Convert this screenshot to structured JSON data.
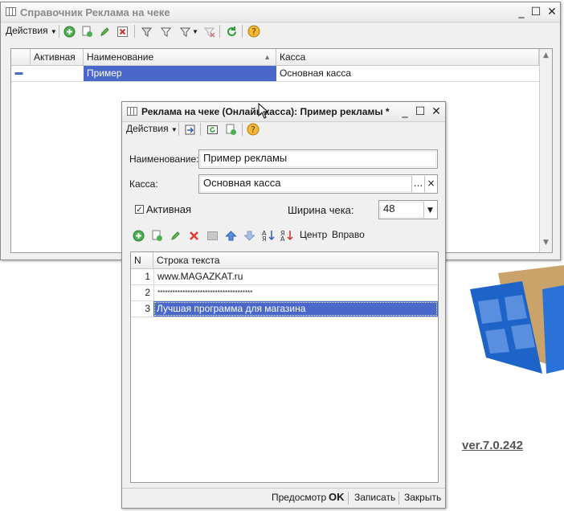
{
  "background": {
    "version": "ver.7.0.242"
  },
  "main_window": {
    "title": "Справочник Реклама на чеке",
    "menu_label": "Действия",
    "columns": [
      "Активная",
      "Наименование",
      "Касса"
    ],
    "rows": [
      {
        "active": "",
        "name": "Пример",
        "register": "Основная касса"
      }
    ]
  },
  "dialog": {
    "title": "Реклама на чеке (Онлайн касса): Пример рекламы *",
    "menu_label": "Действия",
    "name_label": "Наименование:",
    "name_value": "Пример рекламы",
    "register_label": "Касса:",
    "register_value": "Основная касса",
    "register_choose": "...",
    "register_clear": "×",
    "active_label": "Активная",
    "active_checked": true,
    "width_label": "Ширина чека:",
    "width_value": "48",
    "align_center": "Центр",
    "align_right": "Вправо",
    "table": {
      "columns": [
        "N",
        "Строка текста"
      ],
      "rows": [
        {
          "n": "1",
          "text": "www.MAGAZKAT.ru"
        },
        {
          "n": "2",
          "text": "**************************************"
        },
        {
          "n": "3",
          "text": "Лучшая программа для магазина"
        }
      ]
    },
    "footer": {
      "preview": "Предосмотр",
      "ok": "OK",
      "save": "Записать",
      "close": "Закрыть"
    }
  }
}
